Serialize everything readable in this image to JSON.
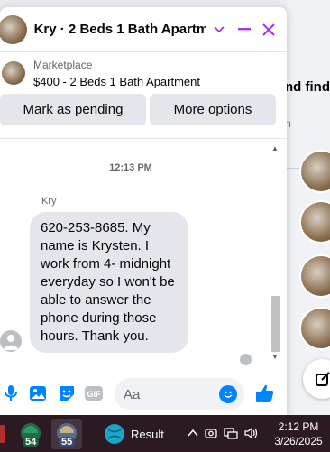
{
  "background": {
    "text": "nd find",
    "sub": "n"
  },
  "chat": {
    "title": "Kry · 2 Beds 1 Bath Apartm...",
    "listing": {
      "source": "Marketplace",
      "name": "$400 - 2 Beds 1 Bath Apartment"
    },
    "actions": {
      "pending": "Mark as pending",
      "more": "More options"
    },
    "thread": {
      "timestamp": "12:13 PM",
      "sender": "Kry",
      "message": "620-253-8685. My name is Krysten. I work from 4- midnight everyday so I won't be able to answer the phone during those hours. Thank you."
    },
    "composer": {
      "placeholder": "Aa"
    }
  },
  "taskbar": {
    "badge_1": "54",
    "badge_2": "55",
    "result_label": "Result",
    "time": "2:12 PM",
    "date": "3/26/2025"
  },
  "colors": {
    "accent": "#a033ff",
    "brand_blue": "#0084ff",
    "bubble": "#e4e6eb"
  }
}
